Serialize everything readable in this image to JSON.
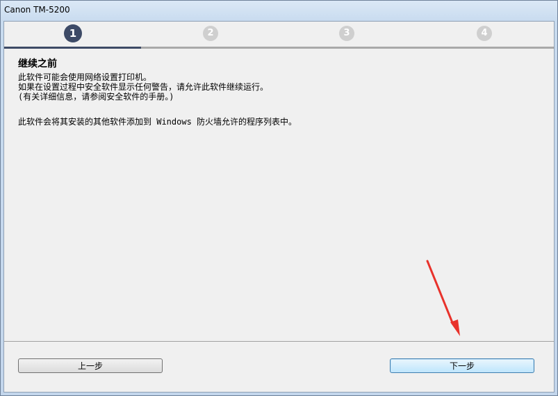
{
  "window": {
    "title": "Canon TM-5200"
  },
  "steps": [
    "1",
    "2",
    "3",
    "4"
  ],
  "active_step": 1,
  "progress_fraction": 0.25,
  "content": {
    "heading": "继续之前",
    "lines": [
      "此软件可能会使用网络设置打印机。",
      "如果在设置过程中安全软件显示任何警告，请允许此软件继续运行。",
      "(有关详细信息，请参阅安全软件的手册。)"
    ],
    "paragraph2": "此软件会将其安装的其他软件添加到 Windows 防火墙允许的程序列表中。"
  },
  "buttons": {
    "back_label": "上一步",
    "next_label": "下一步"
  },
  "colors": {
    "active_step": "#3d4a66",
    "inactive_step": "#cfcfcf",
    "annotation_arrow": "#e8322b"
  },
  "annotation": {
    "icon": "red-arrow-icon"
  }
}
